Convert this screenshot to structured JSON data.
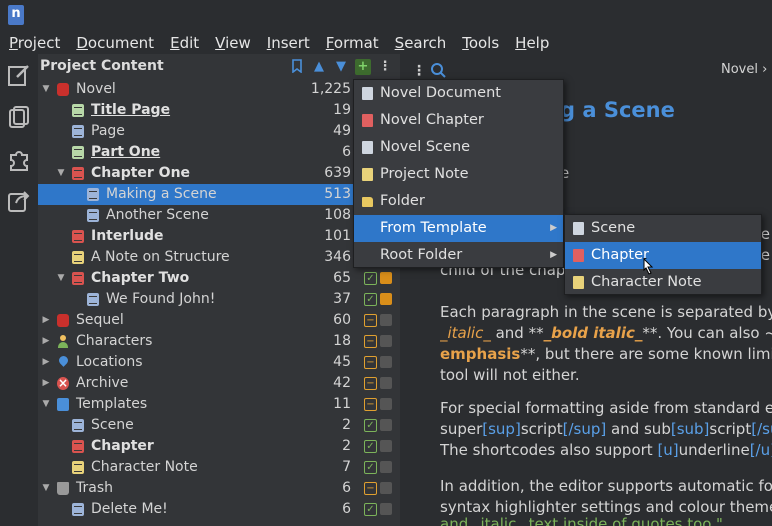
{
  "app": {
    "logo_text": "n"
  },
  "menubar": [
    "Project",
    "Document",
    "Edit",
    "View",
    "Insert",
    "Format",
    "Search",
    "Tools",
    "Help"
  ],
  "sidebar": [
    "project-tree-icon",
    "novel-view-icon",
    "plugins-icon",
    "export-icon"
  ],
  "project_panel": {
    "title": "Project Content",
    "header_icons": [
      "bookmark-icon",
      "move-up-icon",
      "move-down-icon",
      "add-item-icon",
      "more-menu-icon"
    ],
    "rows": [
      {
        "label": "Novel",
        "count": "1,225",
        "indent": 0,
        "arrow": "down",
        "icon": "novelroot",
        "style": ""
      },
      {
        "label": "Title Page",
        "count": "19",
        "indent": 1,
        "arrow": "",
        "icon": "green",
        "style": "bold ul"
      },
      {
        "label": "Page",
        "count": "49",
        "indent": 1,
        "arrow": "",
        "icon": "doc",
        "style": ""
      },
      {
        "label": "Part One",
        "count": "6",
        "indent": 1,
        "arrow": "",
        "icon": "green",
        "style": "bold ul"
      },
      {
        "label": "Chapter One",
        "count": "639",
        "indent": 1,
        "arrow": "down",
        "icon": "red",
        "style": "bold"
      },
      {
        "label": "Making a Scene",
        "count": "513",
        "indent": 2,
        "arrow": "",
        "icon": "doc",
        "style": "",
        "selected": true
      },
      {
        "label": "Another Scene",
        "count": "108",
        "indent": 2,
        "arrow": "",
        "icon": "doc",
        "style": ""
      },
      {
        "label": "Interlude",
        "count": "101",
        "indent": 1,
        "arrow": "",
        "icon": "red",
        "style": "bold"
      },
      {
        "label": "A Note on Structure",
        "count": "346",
        "indent": 1,
        "arrow": "",
        "icon": "yellow",
        "style": ""
      },
      {
        "label": "Chapter Two",
        "count": "65",
        "indent": 1,
        "arrow": "down",
        "icon": "red",
        "style": "bold",
        "status": "check",
        "importance": "orange"
      },
      {
        "label": "We Found John!",
        "count": "37",
        "indent": 2,
        "arrow": "",
        "icon": "doc",
        "style": "",
        "status": "check",
        "importance": "orange"
      },
      {
        "label": "Sequel",
        "count": "60",
        "indent": 0,
        "arrow": "right",
        "icon": "novelroot",
        "style": "",
        "status": "minus",
        "importance": "grey"
      },
      {
        "label": "Characters",
        "count": "18",
        "indent": 0,
        "arrow": "right",
        "icon": "person",
        "style": "",
        "status": "minus",
        "importance": "grey"
      },
      {
        "label": "Locations",
        "count": "45",
        "indent": 0,
        "arrow": "right",
        "icon": "pin",
        "style": "",
        "status": "minus",
        "importance": "grey"
      },
      {
        "label": "Archive",
        "count": "42",
        "indent": 0,
        "arrow": "right",
        "icon": "archive",
        "style": "",
        "status": "minus",
        "importance": "grey"
      },
      {
        "label": "Templates",
        "count": "11",
        "indent": 0,
        "arrow": "down",
        "icon": "templates",
        "style": "",
        "status": "minus",
        "importance": "grey"
      },
      {
        "label": "Scene",
        "count": "2",
        "indent": 1,
        "arrow": "",
        "icon": "doc",
        "style": "",
        "status": "check",
        "importance": "grey"
      },
      {
        "label": "Chapter",
        "count": "2",
        "indent": 1,
        "arrow": "",
        "icon": "red",
        "style": "bold",
        "status": "check",
        "importance": "grey"
      },
      {
        "label": "Character Note",
        "count": "7",
        "indent": 1,
        "arrow": "",
        "icon": "yellow",
        "style": "",
        "status": "check",
        "importance": "grey"
      },
      {
        "label": "Trash",
        "count": "6",
        "indent": 0,
        "arrow": "down",
        "icon": "trash",
        "style": "",
        "status": "minus",
        "importance": "grey"
      },
      {
        "label": "Delete Me!",
        "count": "6",
        "indent": 1,
        "arrow": "",
        "icon": "doc",
        "style": "",
        "status": "check",
        "importance": "grey"
      }
    ]
  },
  "editor": {
    "breadcrumb": "Novel › C",
    "heading": "g a Scene",
    "subline": "e",
    "para1_lines": [
      "e",
      "e",
      "child of the chapt                   ut"
    ],
    "para2": {
      "line1": "Each paragraph in the scene is separated by a b",
      "line2_a": "_italic_",
      "line2_b": " and **",
      "line2_c": "_bold italic_",
      "line2_d": "**. You can also ~~st",
      "line3_a": "emphasis",
      "line3_b": "**, but there are some known limitatio",
      "line4": "tool will not either."
    },
    "para3": {
      "line1": "For special formatting aside from standard emp",
      "line2_a": "super",
      "line2_b": "[sup]",
      "line2_c": "script",
      "line2_d": "[/sup]",
      "line2_e": " and sub",
      "line2_f": "[sub]",
      "line2_g": "script",
      "line2_h": "[/sub]",
      "line3_a": "The shortcodes also support ",
      "line3_b": "[u]",
      "line3_c": "underline",
      "line3_d": "[/u]",
      "line3_e": "."
    },
    "para4": {
      "line1": "In addition, the editor supports automatic form",
      "line2": "syntax highlighter settings and colour theme, th",
      "line3": "and _italic_ text inside of quotes too.\""
    }
  },
  "menu_main": {
    "items": [
      {
        "label": "Novel Document",
        "icon": "doc"
      },
      {
        "label": "Novel Chapter",
        "icon": "red"
      },
      {
        "label": "Novel Scene",
        "icon": "doc"
      },
      {
        "label": "Project Note",
        "icon": "yellow"
      },
      {
        "label": "Folder",
        "icon": "folder"
      },
      {
        "label": "From Template",
        "icon": "",
        "submenu": true,
        "highlighted": true
      },
      {
        "label": "Root Folder",
        "icon": "",
        "submenu": true
      }
    ]
  },
  "menu_template": {
    "items": [
      {
        "label": "Scene",
        "icon": "doc"
      },
      {
        "label": "Chapter",
        "icon": "red",
        "highlighted": true
      },
      {
        "label": "Character Note",
        "icon": "yellow"
      }
    ]
  }
}
